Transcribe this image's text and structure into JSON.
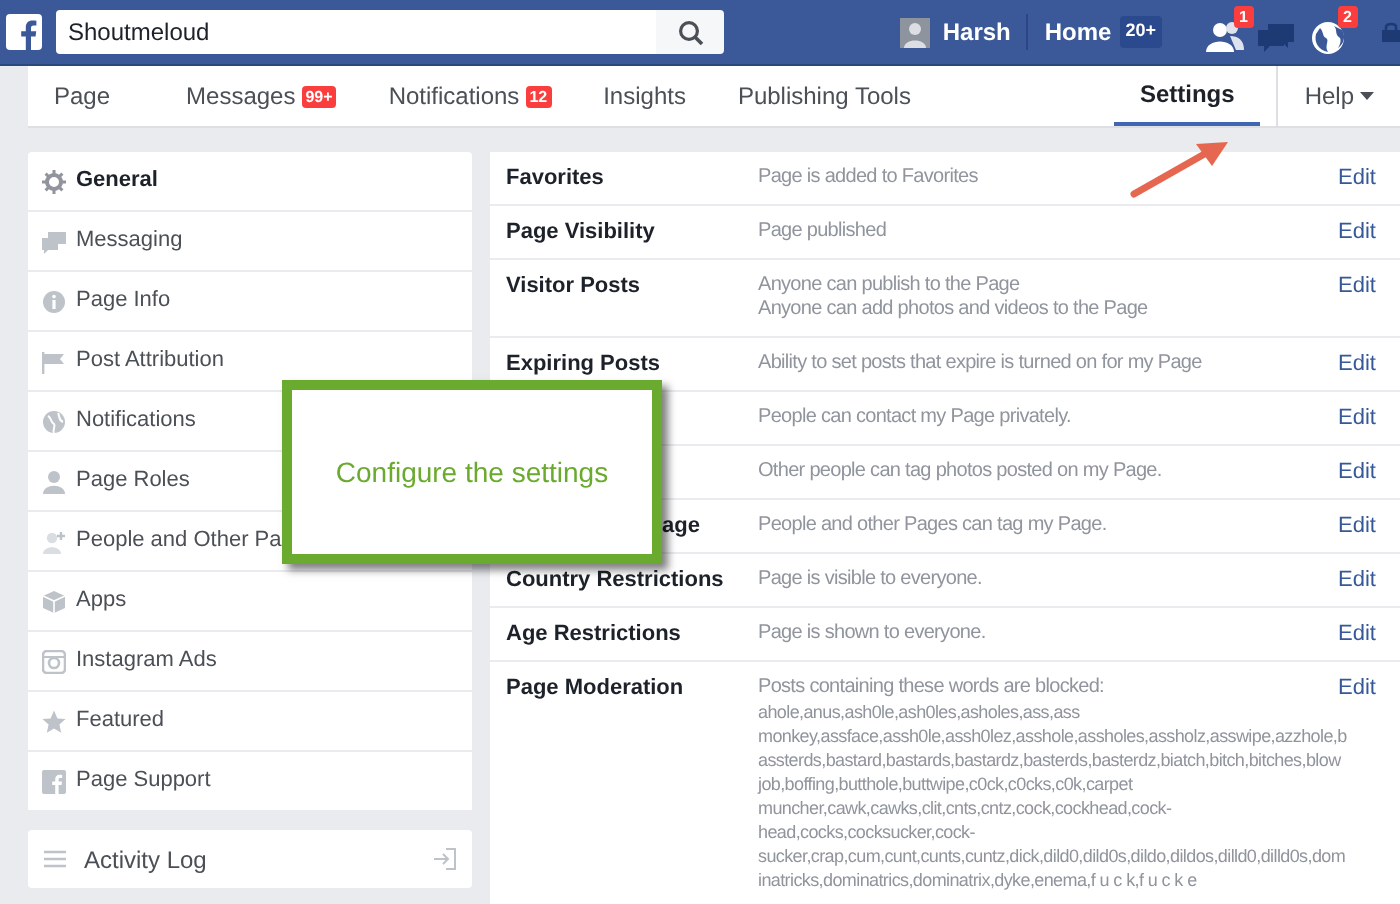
{
  "top_bar": {
    "search": {
      "value": "Shoutmeloud"
    },
    "user": "Harsh",
    "home": {
      "label": "Home",
      "badge": "20+"
    },
    "notifications": [
      {
        "kind": "friends",
        "badge": "1"
      },
      {
        "kind": "messages"
      },
      {
        "kind": "globe",
        "badge": "2"
      }
    ]
  },
  "tabs": [
    {
      "label": "Page",
      "selected": false
    },
    {
      "label": "Messages",
      "badge": "99+",
      "selected": false
    },
    {
      "label": "Notifications",
      "badge": "12",
      "selected": false
    },
    {
      "label": "Insights",
      "selected": false
    },
    {
      "label": "Publishing Tools",
      "selected": false
    },
    {
      "label": "Settings",
      "selected": true
    },
    {
      "label": "Help",
      "kind": "menu",
      "selected": false
    }
  ],
  "sidebar": {
    "items": [
      {
        "label": "General",
        "kind": "gear",
        "selected": true
      },
      {
        "label": "Messaging",
        "kind": "chat",
        "selected": false
      },
      {
        "label": "Page Info",
        "kind": "info",
        "selected": false
      },
      {
        "label": "Post Attribution",
        "kind": "flag",
        "selected": false
      },
      {
        "label": "Notifications",
        "kind": "globe",
        "selected": false
      },
      {
        "label": "Page Roles",
        "kind": "person",
        "selected": false
      },
      {
        "label": "People and Other Pa",
        "kind": "person-plus",
        "selected": false
      },
      {
        "label": "Apps",
        "kind": "cube",
        "selected": false
      },
      {
        "label": "Instagram Ads",
        "kind": "camera",
        "selected": false
      },
      {
        "label": "Featured",
        "kind": "star",
        "selected": false
      },
      {
        "label": "Page Support",
        "kind": "fb",
        "selected": false
      }
    ],
    "activity_log": "Activity Log"
  },
  "settings": [
    {
      "label": "Favorites",
      "value": [
        "Page is added to Favorites"
      ],
      "action": "Edit"
    },
    {
      "label": "Page Visibility",
      "value": [
        "Page published"
      ],
      "action": "Edit"
    },
    {
      "label": "Visitor Posts",
      "value": [
        "Anyone can publish to the Page",
        "Anyone can add photos and videos to the Page"
      ],
      "action": "Edit"
    },
    {
      "label": "Expiring Posts",
      "value": [
        "Ability to set posts that expire is turned on for my Page"
      ],
      "action": "Edit"
    },
    {
      "value": [
        "People can contact my Page privately."
      ],
      "action": "Edit"
    },
    {
      "value": [
        "Other people can tag photos posted on my Page."
      ],
      "action": "Edit"
    },
    {
      "label": "age",
      "cut": true,
      "value": [
        "People and other Pages can tag my Page."
      ],
      "action": "Edit"
    },
    {
      "label": "Country Restrictions",
      "value": [
        "Page is visible to everyone."
      ],
      "action": "Edit"
    },
    {
      "label": "Age Restrictions",
      "value": [
        "Page is shown to everyone."
      ],
      "action": "Edit"
    },
    {
      "label": "Page Moderation",
      "value": [
        "Posts containing these words are blocked:",
        "ahole,anus,ash0le,ash0les,asholes,ass,ass",
        "monkey,assface,assh0le,assh0lez,asshole,assholes,assholz,asswipe,azzhole,b",
        "assterds,bastard,bastards,bastardz,basterds,basterdz,biatch,bitch,bitches,blow",
        "job,boffing,butthole,buttwipe,c0ck,c0cks,c0k,carpet",
        "muncher,cawk,cawks,clit,cnts,cntz,cock,cockhead,cock-",
        "head,cocks,cocksucker,cock-",
        "sucker,crap,cum,cunt,cunts,cuntz,dick,dild0,dild0s,dildo,dildos,dilld0,dilld0s,dom",
        "inatricks,dominatrics,dominatrix,dyke,enema,f u c k,f u c k e"
      ],
      "action": "Edit"
    }
  ],
  "callout": {
    "text": "Configure the settings"
  }
}
